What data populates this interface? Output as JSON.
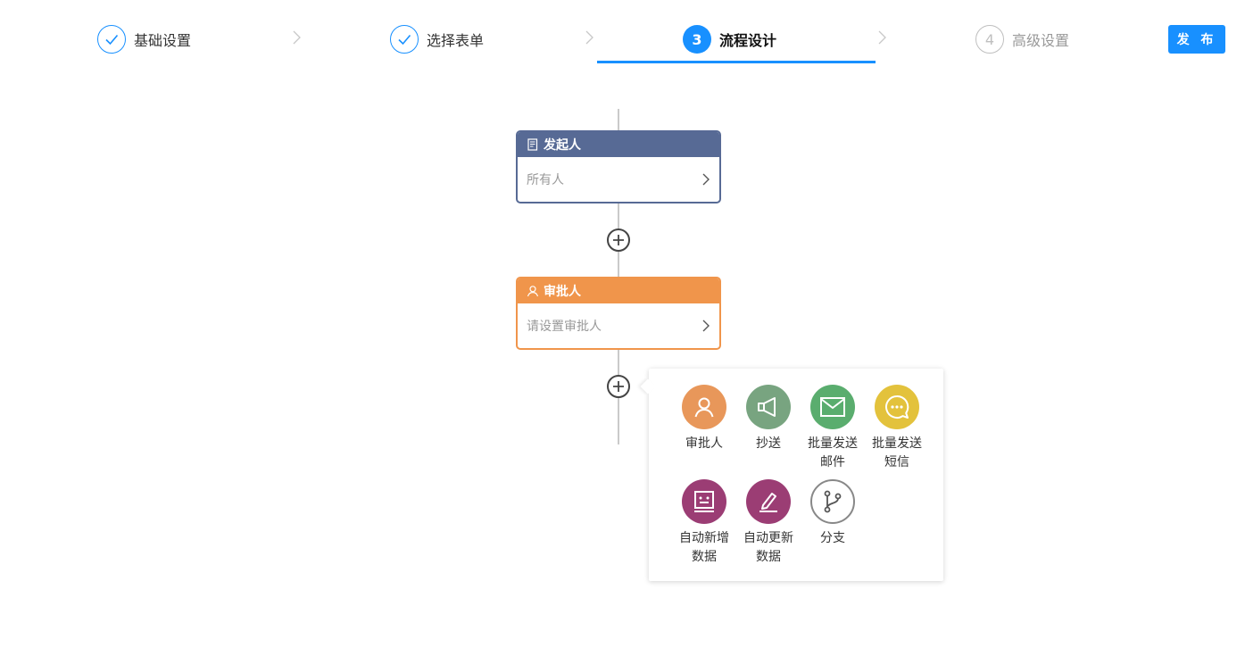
{
  "steps": [
    {
      "label": "基础设置",
      "status": "done"
    },
    {
      "label": "选择表单",
      "status": "done"
    },
    {
      "number": "3",
      "label": "流程设计",
      "status": "active"
    },
    {
      "number": "4",
      "label": "高级设置",
      "status": "todo"
    }
  ],
  "publish_label": "发 布",
  "nodes": {
    "start": {
      "title": "发起人",
      "content": "所有人",
      "icon": "document-icon",
      "color": "#576a95"
    },
    "approver": {
      "title": "审批人",
      "content": "请设置审批人",
      "icon": "user-icon",
      "color": "#f0954b"
    }
  },
  "menu": {
    "items": [
      {
        "line1": "审批人",
        "line2": "",
        "icon": "user-icon",
        "color": "#e8975a"
      },
      {
        "line1": "抄送",
        "line2": "",
        "icon": "megaphone-icon",
        "color": "#78a480"
      },
      {
        "line1": "批量发送",
        "line2": "邮件",
        "icon": "mail-icon",
        "color": "#5aad6e"
      },
      {
        "line1": "批量发送",
        "line2": "短信",
        "icon": "message-icon",
        "color": "#e3c23c"
      },
      {
        "line1": "自动新增",
        "line2": "数据",
        "icon": "data-add-icon",
        "color": "#9b3d74"
      },
      {
        "line1": "自动更新",
        "line2": "数据",
        "icon": "edit-icon",
        "color": "#9b3d74"
      },
      {
        "line1": "分支",
        "line2": "",
        "icon": "branch-icon",
        "color": "#ffffff"
      }
    ]
  },
  "colors": {
    "primary": "#1890ff",
    "line": "#cacaca"
  }
}
